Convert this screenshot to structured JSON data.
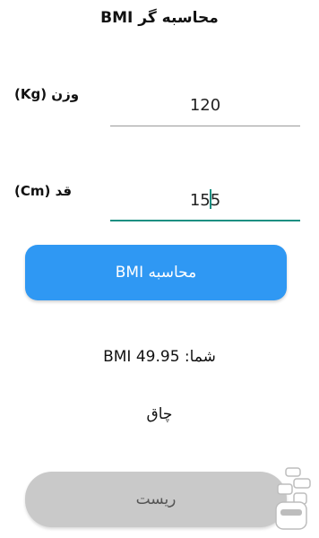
{
  "header": {
    "title": "محاسبه گر BMI"
  },
  "weight": {
    "label": "وزن (Kg)",
    "value": "120"
  },
  "height": {
    "label": "قد (Cm)",
    "value": "155"
  },
  "calculate_button": {
    "label": "محاسبه BMI"
  },
  "result": {
    "text": "شما: BMI 49.95"
  },
  "status": {
    "text": "چاق"
  },
  "reset_button": {
    "label": "ریست"
  },
  "colors": {
    "primary": "#2f98f3",
    "accent": "#1a8f82",
    "reset": "#c9c9c9"
  },
  "watermark": {
    "icon": "store-logo-icon"
  }
}
